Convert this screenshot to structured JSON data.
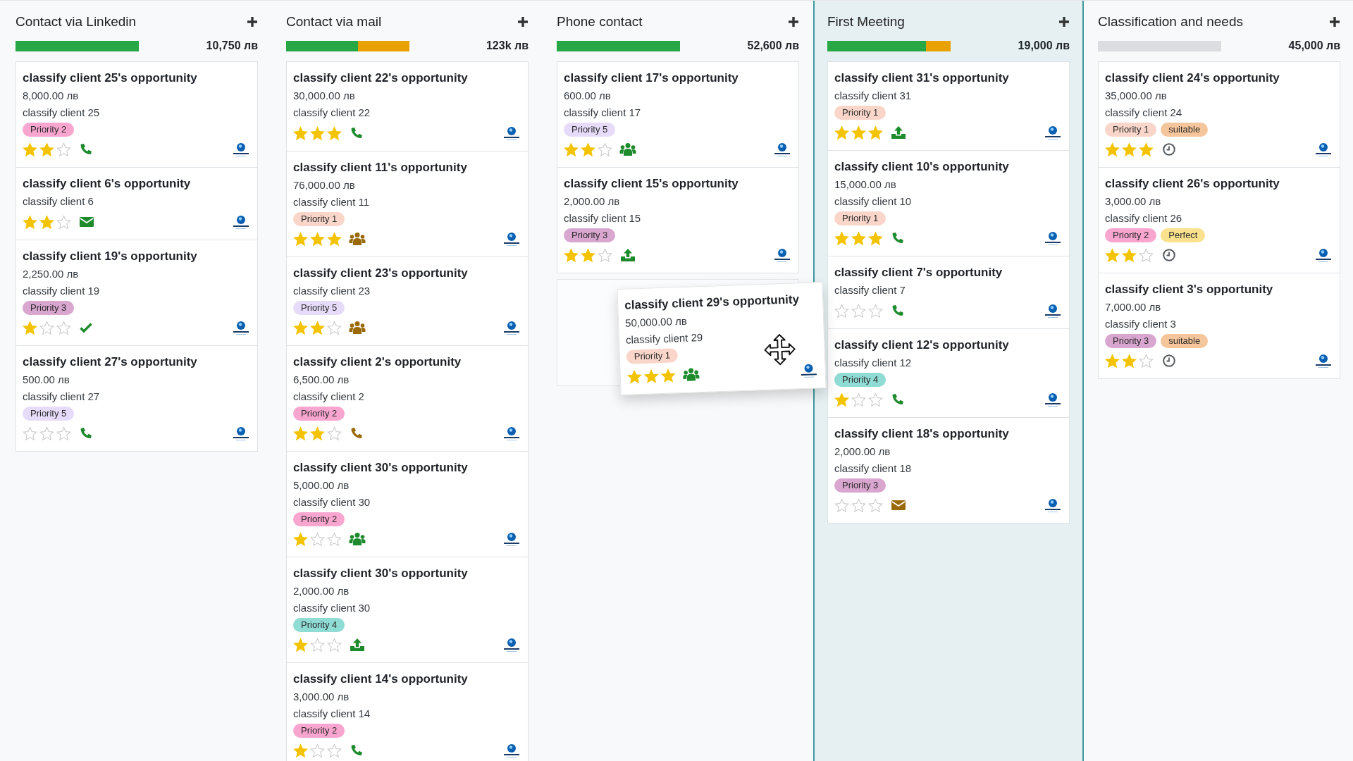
{
  "columns": [
    {
      "title": "Contact via Linkedin",
      "total": "10,750 лв",
      "progress": [
        {
          "kind": "planned",
          "level": 1
        }
      ],
      "cards": [
        {
          "title": "classify client 25's opportunity",
          "amount": "8,000.00 лв",
          "customer": "classify client 25",
          "tags": [
            {
              "label": "Priority 2",
              "color": "#f8a5cf"
            }
          ],
          "stars": 2,
          "activity": {
            "kind": "phone",
            "color": "#1d8a2c"
          }
        },
        {
          "title": "classify client 6's opportunity",
          "customer": "classify client 6",
          "stars": 2,
          "activity": {
            "kind": "email",
            "color": "#1d8a2c"
          }
        },
        {
          "title": "classify client 19's opportunity",
          "amount": "2,250.00 лв",
          "customer": "classify client 19",
          "tags": [
            {
              "label": "Priority 3",
              "color": "#d9a6d0"
            }
          ],
          "stars": 1,
          "activity": {
            "kind": "check",
            "color": "#1d8a2c"
          }
        },
        {
          "title": "classify client 27's opportunity",
          "amount": "500.00 лв",
          "customer": "classify client 27",
          "tags": [
            {
              "label": "Priority 5",
              "color": "#e6dcf9"
            }
          ],
          "stars": 0,
          "activity": {
            "kind": "phone",
            "color": "#1d8a2c"
          }
        }
      ]
    },
    {
      "title": "Contact via mail",
      "total": "123k лв",
      "progress": [
        {
          "kind": "planned",
          "level": 0.58
        },
        {
          "kind": "today",
          "level": 0.42
        }
      ],
      "cards": [
        {
          "title": "classify client 22's opportunity",
          "amount": "30,000.00 лв",
          "customer": "classify client 22",
          "stars": 3,
          "activity": {
            "kind": "phone",
            "color": "#1d8a2c"
          }
        },
        {
          "title": "classify client 11's opportunity",
          "amount": "76,000.00 лв",
          "customer": "classify client 11",
          "tags": [
            {
              "label": "Priority 1",
              "color": "#f9d6c9"
            }
          ],
          "stars": 3,
          "activity": {
            "kind": "group",
            "color": "#9a6a08"
          }
        },
        {
          "title": "classify client 23's opportunity",
          "customer": "classify client 23",
          "tags": [
            {
              "label": "Priority 5",
              "color": "#e6dcf9"
            }
          ],
          "stars": 2,
          "activity": {
            "kind": "group",
            "color": "#9a6a08"
          }
        },
        {
          "title": "classify client 2's opportunity",
          "amount": "6,500.00 лв",
          "customer": "classify client 2",
          "tags": [
            {
              "label": "Priority 2",
              "color": "#f8a5cf"
            }
          ],
          "stars": 2,
          "activity": {
            "kind": "phone",
            "color": "#9a6a08"
          }
        },
        {
          "title": "classify client 30's opportunity",
          "amount": "5,000.00 лв",
          "customer": "classify client 30",
          "tags": [
            {
              "label": "Priority 2",
              "color": "#f8a5cf"
            }
          ],
          "stars": 1,
          "activity": {
            "kind": "group",
            "color": "#1d8a2c"
          }
        },
        {
          "title": "classify client 30's opportunity",
          "amount": "2,000.00 лв",
          "customer": "classify client 30",
          "tags": [
            {
              "label": "Priority 4",
              "color": "#8fdcd5"
            }
          ],
          "stars": 1,
          "activity": {
            "kind": "upload",
            "color": "#1d8a2c"
          }
        },
        {
          "title": "classify client 14's opportunity",
          "amount": "3,000.00 лв",
          "customer": "classify client 14",
          "tags": [
            {
              "label": "Priority 2",
              "color": "#f8a5cf"
            }
          ],
          "stars": 1,
          "activity": {
            "kind": "phone",
            "color": "#1d8a2c"
          }
        }
      ]
    },
    {
      "title": "Phone contact",
      "total": "52,600 лв",
      "placeholder": true,
      "progress": [
        {
          "kind": "planned",
          "level": 1
        }
      ],
      "cards": [
        {
          "title": "classify client 17's opportunity",
          "amount": "600.00 лв",
          "customer": "classify client 17",
          "tags": [
            {
              "label": "Priority 5",
              "color": "#e6dcf9"
            }
          ],
          "stars": 2,
          "activity": {
            "kind": "group",
            "color": "#1d8a2c"
          }
        },
        {
          "title": "classify client 15's opportunity",
          "amount": "2,000.00 лв",
          "customer": "classify client 15",
          "tags": [
            {
              "label": "Priority 3",
              "color": "#d9a6d0"
            }
          ],
          "stars": 2,
          "activity": {
            "kind": "upload",
            "color": "#1d8a2c"
          }
        }
      ]
    },
    {
      "title": "First Meeting",
      "total": "19,000 лв",
      "highlighted": true,
      "progress": [
        {
          "kind": "planned",
          "level": 0.8
        },
        {
          "kind": "today",
          "level": 0.2
        }
      ],
      "cards": [
        {
          "title": "classify client 31's opportunity",
          "customer": "classify client 31",
          "tags": [
            {
              "label": "Priority 1",
              "color": "#f9d6c9"
            }
          ],
          "stars": 3,
          "activity": {
            "kind": "upload",
            "color": "#1d8a2c"
          }
        },
        {
          "title": "classify client 10's opportunity",
          "amount": "15,000.00 лв",
          "customer": "classify client 10",
          "tags": [
            {
              "label": "Priority 1",
              "color": "#f9d6c9"
            }
          ],
          "stars": 3,
          "activity": {
            "kind": "phone",
            "color": "#1d8a2c"
          }
        },
        {
          "title": "classify client 7's opportunity",
          "customer": "classify client 7",
          "stars": 0,
          "activity": {
            "kind": "phone",
            "color": "#1d8a2c"
          }
        },
        {
          "title": "classify client 12's opportunity",
          "customer": "classify client 12",
          "tags": [
            {
              "label": "Priority 4",
              "color": "#8fdcd5"
            }
          ],
          "stars": 1,
          "activity": {
            "kind": "phone",
            "color": "#1d8a2c"
          }
        },
        {
          "title": "classify client 18's opportunity",
          "amount": "2,000.00 лв",
          "customer": "classify client 18",
          "tags": [
            {
              "label": "Priority 3",
              "color": "#d9a6d0"
            }
          ],
          "stars": 0,
          "activity": {
            "kind": "email",
            "color": "#9a6a08"
          }
        }
      ]
    },
    {
      "title": "Classification and needs",
      "total": "45,000 лв",
      "cards": [
        {
          "title": "classify client 24's opportunity",
          "amount": "35,000.00 лв",
          "customer": "classify client 24",
          "tags": [
            {
              "label": "Priority 1",
              "color": "#f9d6c9"
            },
            {
              "label": "suitable",
              "color": "#f5c69b"
            }
          ],
          "stars": 3,
          "activity": {
            "kind": "clock",
            "color": "#555b61"
          }
        },
        {
          "title": "classify client 26's opportunity",
          "amount": "3,000.00 лв",
          "customer": "classify client 26",
          "tags": [
            {
              "label": "Priority 2",
              "color": "#f8a5cf"
            },
            {
              "label": "Perfect",
              "color": "#f9e18d"
            }
          ],
          "stars": 2,
          "activity": {
            "kind": "clock",
            "color": "#555b61"
          }
        },
        {
          "title": "classify client 3's opportunity",
          "amount": "7,000.00 лв",
          "customer": "classify client 3",
          "tags": [
            {
              "label": "Priority 3",
              "color": "#d9a6d0"
            },
            {
              "label": "suitable",
              "color": "#f5c69b"
            }
          ],
          "stars": 2,
          "activity": {
            "kind": "clock",
            "color": "#555b61"
          }
        }
      ]
    }
  ],
  "dragged_card": {
    "title": "classify client 29's opportunity",
    "amount": "50,000.00 лв",
    "customer": "classify client 29",
    "tags": [
      {
        "label": "Priority 1",
        "color": "#f9d6c9"
      }
    ],
    "stars": 3,
    "activity": {
      "kind": "group",
      "color": "#1d8a2c"
    }
  }
}
